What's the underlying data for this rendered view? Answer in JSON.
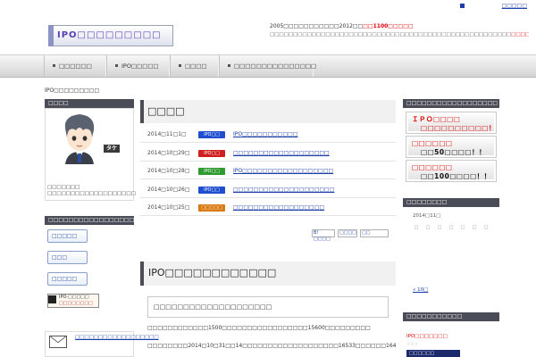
{
  "header": {
    "top_link": "□□□□□",
    "logo_text": "IPO□□□□□□□□□",
    "intro_line1_prefix": "2005□□□□□□□□□□□2012□□",
    "intro_line1_red": "□□1100□□□□□",
    "intro_line2": "□□□□□□□□□□□□□□□□□□□□□□□□□□□□□□□□□□□□□□□□□□□□□□□□□□□□",
    "intro_line2_red": "□□□□□□□"
  },
  "nav": {
    "items": [
      {
        "label": "□□□□□□"
      },
      {
        "label": "IPO□□□□□"
      },
      {
        "label": "□□□□"
      },
      {
        "label": "□□□□□□□□□□□□□□□"
      }
    ]
  },
  "breadcrumb": "IPO□□□□□□□□□",
  "left_sidebar": {
    "profile_heading": "□□□□",
    "avatar_name": "タケ",
    "profile_text": "□□□□□□□ □□□□□□□□□□□□□□□□□□□",
    "links_heading": "□□□□□□□□□□□□□□□□□□",
    "banners": [
      {
        "label": "□□□□□"
      },
      {
        "label": "□□□"
      },
      {
        "label": "□□□□□"
      }
    ],
    "rank_banner_line1": "IPO·□□□□□",
    "rank_banner_line2": "□□□□□□□□",
    "mail_link": "□□□□□□□□□□□□□□□□□□"
  },
  "main": {
    "title": "□□□□",
    "news": [
      {
        "date": "2014□11□1□",
        "badge": "IPO□□",
        "badge_color": "#1f4fcf",
        "title": "IPO□□□□□□□□□□□"
      },
      {
        "date": "2014□10□29□",
        "badge": "IPO□□",
        "badge_color": "#d01f1f",
        "title": "□□□□□□□□□□□□□□□□□□□"
      },
      {
        "date": "2014□10□28□",
        "badge": "IPO□□",
        "badge_color": "#2f9a2f",
        "title": "IPO□□□□□□□□□□□□□□□□□□"
      },
      {
        "date": "2014□10□26□",
        "badge": "IPO□□",
        "badge_color": "#1f4fcf",
        "title": "□□□□□□□□□□□□□□□□□□□□"
      },
      {
        "date": "2014□10□25□",
        "badge": "□□□□□",
        "badge_color": "#d87a10",
        "title": "□□□□□□□□□□□□□□□□□□"
      }
    ],
    "share": {
      "hatena": "B! □□□□",
      "tweet": "□□□□",
      "like": "□□"
    },
    "article_title": "IPO□□□□□□□□□□□□",
    "article_quote": "□□□□□□□□□□□□□□□□□□□□",
    "article_p1": "□□□□□□□□□□□□1500□□□□□□□□□□□□□□□□□15600□□□□□□□□□",
    "article_p2": "□□□□□□□□2014□10□31□□14□□□□□□□□□□□□□□□□□□□16533□□□□□□16413□□□□□□□□□"
  },
  "right_sidebar": {
    "ad_heading": "□□□□□□□□□□□□□□□□□□",
    "ads": [
      {
        "line1": "ＩＰＯ□□□□",
        "line2": "□□□□□□□□□□！"
      },
      {
        "line1": "□□□□□□",
        "line2": "□□50□□□□！！"
      },
      {
        "line1": "□□□□□□",
        "line2": "□□100□□□□！！"
      }
    ],
    "calendar_heading": "□□□□□□□□",
    "calendar_caption": "2014□11□",
    "calendar_weekdays": [
      "□",
      "□",
      "□",
      "□",
      "□",
      "□",
      "□"
    ],
    "calendar_prev": "« 10□",
    "recent_heading": "□□□□□□□□□□□",
    "recent_link": "IPO□□□□□□□",
    "recent_stars": "☆☆☆",
    "recent_banner": "□□□□□□"
  }
}
